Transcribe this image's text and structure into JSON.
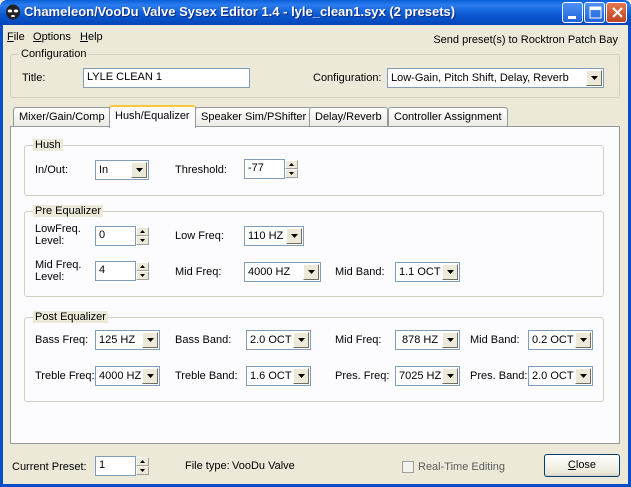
{
  "window": {
    "title": "Chameleon/VooDu Valve Sysex Editor 1.4 - lyle_clean1.syx (2 presets)"
  },
  "menu": {
    "file": {
      "pre": "",
      "key": "F",
      "post": "ile"
    },
    "options": {
      "pre": "",
      "key": "O",
      "post": "ptions"
    },
    "help": {
      "pre": "",
      "key": "H",
      "post": "elp"
    }
  },
  "send_label": "Send preset(s) to Rocktron Patch Bay",
  "configuration_group": {
    "label": "Configuration",
    "title_label": "Title:",
    "title_value": "LYLE CLEAN 1",
    "config_label": "Configuration:",
    "config_value": "Low-Gain, Pitch Shift, Delay, Reverb"
  },
  "tabs": [
    "Mixer/Gain/Comp",
    "Hush/Equalizer",
    "Speaker Sim/PShifter",
    "Delay/Reverb",
    "Controller Assignment"
  ],
  "active_tab": "Hush/Equalizer",
  "hush": {
    "label": "Hush",
    "inout_label": "In/Out:",
    "inout_value": "In",
    "threshold_label": "Threshold:",
    "threshold_value": "-77"
  },
  "pre_eq": {
    "label": "Pre Equalizer",
    "lowfreq_level_label_1": "LowFreq.",
    "lowfreq_level_label_2": "Level:",
    "lowfreq_level_value": "0",
    "low_freq_label": "Low Freq:",
    "low_freq_value": "110 HZ",
    "midfreq_level_label_1": "Mid Freq.",
    "midfreq_level_label_2": "Level:",
    "midfreq_level_value": "4",
    "mid_freq_label": "Mid Freq:",
    "mid_freq_value": "4000 HZ",
    "mid_band_label": "Mid Band:",
    "mid_band_value": "1.1 OCT"
  },
  "post_eq": {
    "label": "Post Equalizer",
    "bass_freq_label": "Bass Freq:",
    "bass_freq_value": "125 HZ",
    "bass_band_label": "Bass Band:",
    "bass_band_value": "2.0 OCT",
    "mid_freq_label": "Mid Freq:",
    "mid_freq_value": "878 HZ",
    "mid_band_label": "Mid Band:",
    "mid_band_value": "0.2 OCT",
    "treble_freq_label": "Treble Freq:",
    "treble_freq_value": "4000 HZ",
    "treble_band_label": "Treble Band:",
    "treble_band_value": "1.6 OCT",
    "pres_freq_label": "Pres. Freq:",
    "pres_freq_value": "7025 HZ",
    "pres_band_label": "Pres. Band:",
    "pres_band_value": "2.0 OCT"
  },
  "footer": {
    "current_preset_label": "Current Preset:",
    "current_preset_value": "1",
    "file_type_label": "File type:",
    "file_type_value": "VooDu Valve",
    "realtime_label": "Real-Time Editing",
    "realtime_checked": false,
    "close": {
      "pre": "",
      "key": "C",
      "post": "lose"
    }
  },
  "icons": {
    "app": "alien-head-icon",
    "minimize": "minimize-icon",
    "maximize": "maximize-icon",
    "close": "close-icon",
    "dropdown": "chevron-down-icon",
    "spin_up": "spin-up-arrow-icon",
    "spin_down": "spin-down-arrow-icon"
  },
  "colors": {
    "titlebar": "#0a58d0",
    "window_bg": "#ece9d8",
    "tab_highlight": "#ffc83c",
    "close_button": "#c0421f"
  }
}
